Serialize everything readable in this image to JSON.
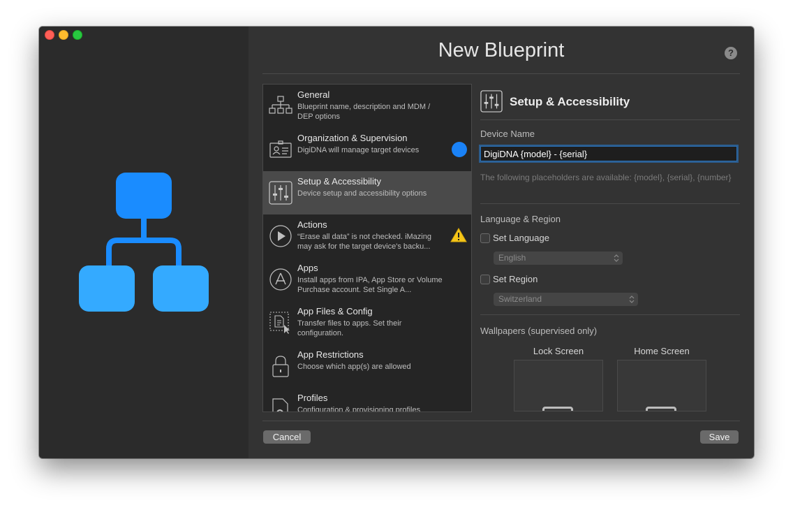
{
  "window": {
    "title": "New Blueprint",
    "help_label": "?"
  },
  "colors": {
    "accent": "#1a82f7",
    "hierarchy_top": "#1a8cff",
    "hierarchy_bottom": "#34aaff",
    "warning": "#f5c518"
  },
  "sidebar": {
    "items": [
      {
        "title": "General",
        "desc": "Blueprint name, description and MDM / DEP options",
        "icon": "hierarchy-icon"
      },
      {
        "title": "Organization & Supervision",
        "desc": "DigiDNA will manage target devices",
        "icon": "id-card-icon",
        "badge": "blue-dot"
      },
      {
        "title": "Setup & Accessibility",
        "desc": "Device setup and accessibility options",
        "icon": "sliders-icon",
        "selected": true
      },
      {
        "title": "Actions",
        "desc": "“Erase all data” is not checked. iMazing may ask for the target device's backu...",
        "icon": "play-icon",
        "badge": "warning-icon"
      },
      {
        "title": "Apps",
        "desc": "Install apps from IPA, App Store or Volume Purchase account. Set Single A...",
        "icon": "app-store-icon"
      },
      {
        "title": "App Files & Config",
        "desc": "Transfer files to apps. Set their configuration.",
        "icon": "file-drop-icon"
      },
      {
        "title": "App Restrictions",
        "desc": "Choose which app(s) are allowed",
        "icon": "lock-icon"
      },
      {
        "title": "Profiles",
        "desc": "Configuration & provisioning profiles",
        "icon": "profile-gear-icon"
      }
    ]
  },
  "detail": {
    "title": "Setup & Accessibility",
    "device_name_label": "Device Name",
    "device_name_value": "DigiDNA {model} - {serial}",
    "placeholder_hint": "The following placeholders are available: {model}, {serial}, {number}",
    "language_region_label": "Language & Region",
    "set_language_label": "Set Language",
    "set_language_checked": false,
    "language_value": "English",
    "set_region_label": "Set Region",
    "set_region_checked": false,
    "region_value": "Switzerland",
    "wallpapers_label": "Wallpapers (supervised only)",
    "lock_screen_label": "Lock Screen",
    "home_screen_label": "Home Screen"
  },
  "footer": {
    "cancel_label": "Cancel",
    "save_label": "Save"
  }
}
